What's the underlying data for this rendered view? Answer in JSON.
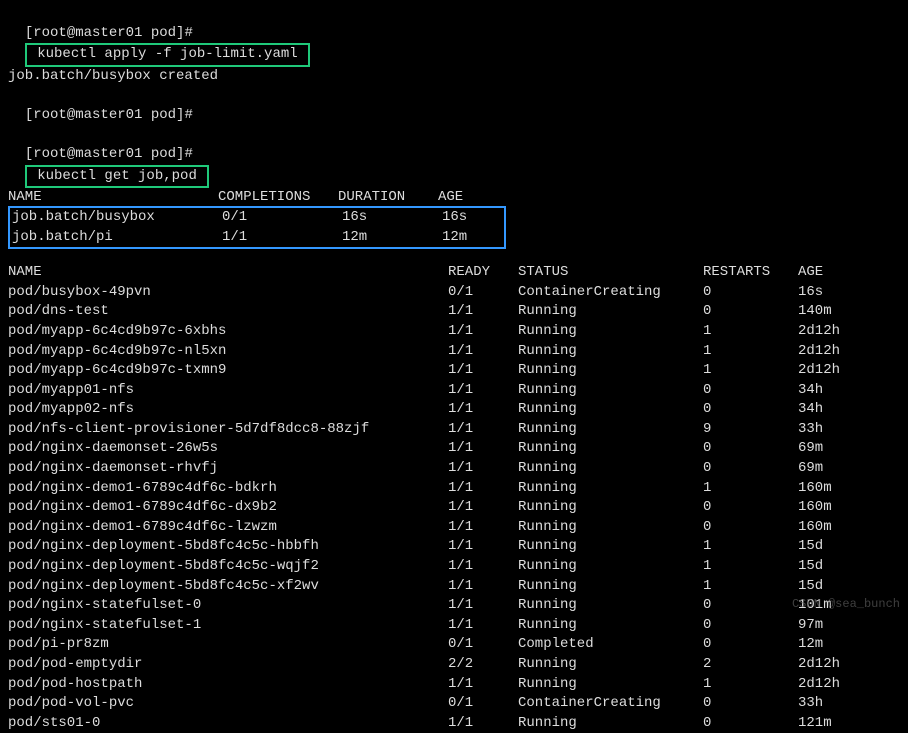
{
  "prompt": {
    "user_host": "[root@master01 pod]#",
    "cmd1": " kubectl apply -f job-limit.yaml ",
    "cmd2": " kubectl get job,pod "
  },
  "output_line1": "job.batch/busybox created",
  "job_header": {
    "name": "NAME",
    "completions": "COMPLETIONS",
    "duration": "DURATION",
    "age": "AGE"
  },
  "jobs": [
    {
      "name": "job.batch/busybox",
      "completions": "0/1",
      "duration": "16s",
      "age": "16s"
    },
    {
      "name": "job.batch/pi",
      "completions": "1/1",
      "duration": "12m",
      "age": "12m"
    }
  ],
  "pod_header": {
    "name": "NAME",
    "ready": "READY",
    "status": "STATUS",
    "restarts": "RESTARTS",
    "age": "AGE"
  },
  "pods": [
    {
      "name": "pod/busybox-49pvn",
      "ready": "0/1",
      "status": "ContainerCreating",
      "restarts": "0",
      "age": "16s"
    },
    {
      "name": "pod/dns-test",
      "ready": "1/1",
      "status": "Running",
      "restarts": "0",
      "age": "140m"
    },
    {
      "name": "pod/myapp-6c4cd9b97c-6xbhs",
      "ready": "1/1",
      "status": "Running",
      "restarts": "1",
      "age": "2d12h"
    },
    {
      "name": "pod/myapp-6c4cd9b97c-nl5xn",
      "ready": "1/1",
      "status": "Running",
      "restarts": "1",
      "age": "2d12h"
    },
    {
      "name": "pod/myapp-6c4cd9b97c-txmn9",
      "ready": "1/1",
      "status": "Running",
      "restarts": "1",
      "age": "2d12h"
    },
    {
      "name": "pod/myapp01-nfs",
      "ready": "1/1",
      "status": "Running",
      "restarts": "0",
      "age": "34h"
    },
    {
      "name": "pod/myapp02-nfs",
      "ready": "1/1",
      "status": "Running",
      "restarts": "0",
      "age": "34h"
    },
    {
      "name": "pod/nfs-client-provisioner-5d7df8dcc8-88zjf",
      "ready": "1/1",
      "status": "Running",
      "restarts": "9",
      "age": "33h"
    },
    {
      "name": "pod/nginx-daemonset-26w5s",
      "ready": "1/1",
      "status": "Running",
      "restarts": "0",
      "age": "69m"
    },
    {
      "name": "pod/nginx-daemonset-rhvfj",
      "ready": "1/1",
      "status": "Running",
      "restarts": "0",
      "age": "69m"
    },
    {
      "name": "pod/nginx-demo1-6789c4df6c-bdkrh",
      "ready": "1/1",
      "status": "Running",
      "restarts": "1",
      "age": "160m"
    },
    {
      "name": "pod/nginx-demo1-6789c4df6c-dx9b2",
      "ready": "1/1",
      "status": "Running",
      "restarts": "0",
      "age": "160m"
    },
    {
      "name": "pod/nginx-demo1-6789c4df6c-lzwzm",
      "ready": "1/1",
      "status": "Running",
      "restarts": "0",
      "age": "160m"
    },
    {
      "name": "pod/nginx-deployment-5bd8fc4c5c-hbbfh",
      "ready": "1/1",
      "status": "Running",
      "restarts": "1",
      "age": "15d"
    },
    {
      "name": "pod/nginx-deployment-5bd8fc4c5c-wqjf2",
      "ready": "1/1",
      "status": "Running",
      "restarts": "1",
      "age": "15d"
    },
    {
      "name": "pod/nginx-deployment-5bd8fc4c5c-xf2wv",
      "ready": "1/1",
      "status": "Running",
      "restarts": "1",
      "age": "15d"
    },
    {
      "name": "pod/nginx-statefulset-0",
      "ready": "1/1",
      "status": "Running",
      "restarts": "0",
      "age": "101m"
    },
    {
      "name": "pod/nginx-statefulset-1",
      "ready": "1/1",
      "status": "Running",
      "restarts": "0",
      "age": "97m"
    },
    {
      "name": "pod/pi-pr8zm",
      "ready": "0/1",
      "status": "Completed",
      "restarts": "0",
      "age": "12m"
    },
    {
      "name": "pod/pod-emptydir",
      "ready": "2/2",
      "status": "Running",
      "restarts": "2",
      "age": "2d12h"
    },
    {
      "name": "pod/pod-hostpath",
      "ready": "1/1",
      "status": "Running",
      "restarts": "1",
      "age": "2d12h"
    },
    {
      "name": "pod/pod-vol-pvc",
      "ready": "0/1",
      "status": "ContainerCreating",
      "restarts": "0",
      "age": "33h"
    },
    {
      "name": "pod/sts01-0",
      "ready": "1/1",
      "status": "Running",
      "restarts": "0",
      "age": "121m"
    }
  ],
  "watermark": "CSDN @sea_bunch"
}
